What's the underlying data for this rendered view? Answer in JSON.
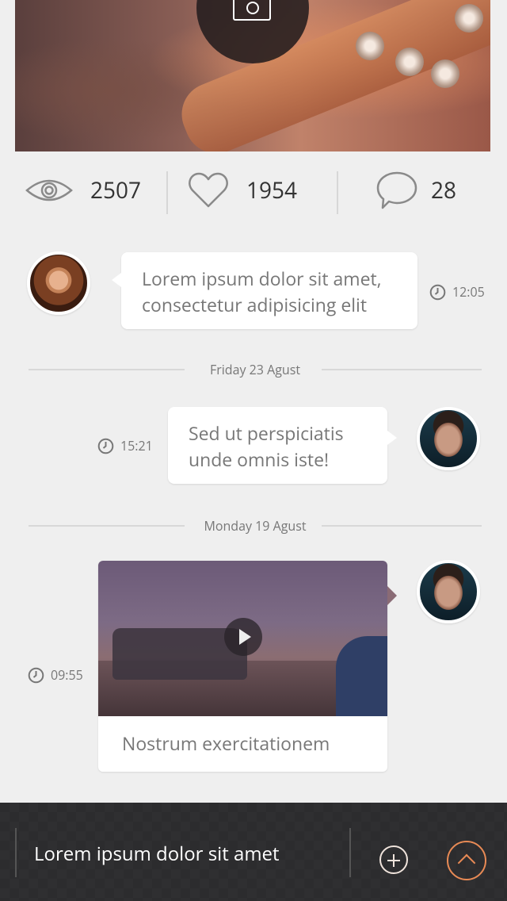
{
  "stats": {
    "views": "2507",
    "likes": "1954",
    "comments": "28"
  },
  "messages": [
    {
      "text": "Lorem ipsum dolor sit amet, consectetur adipisicing elit",
      "time": "12:05"
    },
    {
      "text": "Sed ut perspiciatis unde omnis iste!",
      "time": "15:21"
    },
    {
      "caption": "Nostrum exercitationem",
      "time": "09:55"
    }
  ],
  "separators": [
    "Friday 23 Agust",
    "Monday 19 Agust"
  ],
  "composer": {
    "text": "Lorem ipsum dolor sit amet"
  },
  "colors": {
    "accent": "#e88a55",
    "background": "#efefef",
    "composer_bg": "#2c2c2e"
  },
  "icons": [
    "camera-icon",
    "eye-icon",
    "heart-icon",
    "comment-icon",
    "clock-icon",
    "play-icon",
    "plus-icon",
    "chevron-up-icon"
  ]
}
